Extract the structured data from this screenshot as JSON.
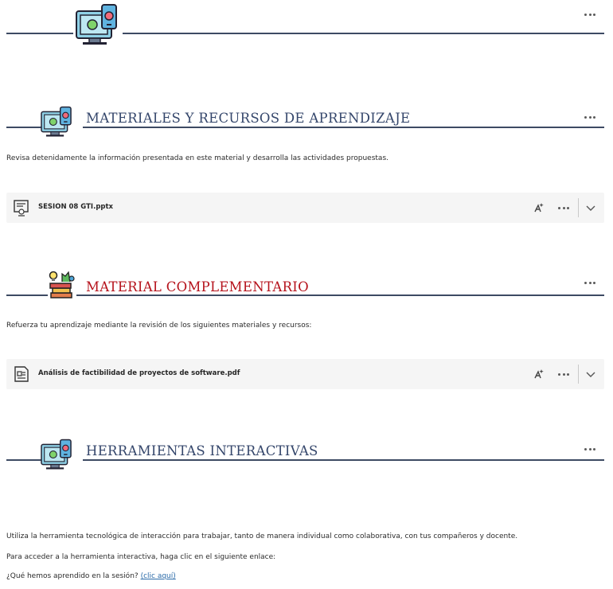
{
  "sections": [
    {
      "title": "MATERIALES Y RECURSOS DE APRENDIZAJE",
      "title_color": "#34466b"
    },
    {
      "title": "MATERIAL COMPLEMENTARIO",
      "title_color": "#b5121b"
    },
    {
      "title": "HERRAMIENTAS INTERACTIVAS",
      "title_color": "#34466b"
    }
  ],
  "paragraphs": {
    "materials_intro": "Revisa detenidamente la información presentada en este material y desarrolla las actividades propuestas.",
    "complementary_intro": "Refuerza tu aprendizaje mediante la revisión de los siguientes materiales y recursos:",
    "tools_intro": "Utiliza la herramienta tecnológica de interacción para trabajar, tanto de manera individual como colaborativa, con tus compañeros y docente.",
    "tools_access": "Para acceder a la herramienta interactiva, haga clic en el siguiente enlace:",
    "question": "¿Qué hemos aprendido en la sesión?",
    "link": "(clic aquí)"
  },
  "files": [
    {
      "name": "SESION 08 GTI.pptx",
      "icon": "presentation-file-icon"
    },
    {
      "name": "Análisis de factibilidad de proyectos de software.pdf",
      "icon": "document-file-icon"
    }
  ],
  "icons": {
    "more": "more-options-icon",
    "ai_assist": "ai-sparkle-icon",
    "expand": "chevron-down-icon",
    "section": "device-screen-icon",
    "books": "books-lightbulb-icon"
  },
  "colors": {
    "rule": "#3d4a63",
    "file_bg": "#f5f5f5",
    "link": "#2a6aa8"
  }
}
